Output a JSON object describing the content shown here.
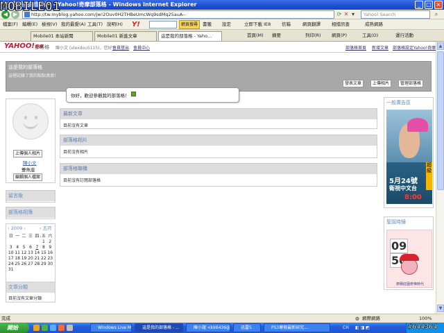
{
  "watermark": "MOBILE01",
  "window": {
    "title": "我是我的部落格 - Yahoo!奇摩部落格 - Windows Internet Explorer",
    "min": "_",
    "max": "□",
    "close": "×"
  },
  "address": {
    "url": "http://tw.myblog.yahoo.com/jw!2Ouv0H2THBeUmcWq9sdMq25auA--",
    "search_placeholder": "Yahoo! Search"
  },
  "menu": [
    "檔案(F)",
    "編輯(E)",
    "檢視(V)",
    "我的最愛(A)",
    "工具(T)",
    "說明(H)"
  ],
  "toolbar": {
    "search_btn": "網頁搜尋",
    "items": [
      "書籤",
      "設定",
      "立即下載 IE8",
      "信箱",
      "網頁翻譯",
      "相擋訊查",
      "成熟網路"
    ]
  },
  "tabs": [
    "Mobile01 本站新聞",
    "Mobile01 新進文章",
    "這是我的部落格 - Yaho..."
  ],
  "commands": [
    "首頁(M)",
    "摘要",
    "列印(R)",
    "網頁(P)",
    "工具(O)",
    "運行活動"
  ],
  "site": {
    "logo": "YAHOO!",
    "logo_sub": "奇摩",
    "label": "部落格",
    "greeting": "陳小文 (vlexdou5115)，您好！",
    "links_left": [
      "會員登出",
      "會員中心"
    ],
    "links_right": [
      "部落格首頁",
      "新增文章",
      "部落格設定",
      "Yahoo!奇摩"
    ]
  },
  "banner": {
    "title": "這是我的部落格",
    "subtitle": "這裡記錄了我的點點滴滴！",
    "buttons": [
      "發表文章",
      "上傳相片",
      "管理部落格"
    ]
  },
  "welcome": "你好，歡迎參觀我的部落格！",
  "profile": {
    "upload_btn": "上傳個人相片",
    "name": "陳小文",
    "sign": "雙魚座",
    "edit_btn": "編輯個人檔案"
  },
  "left_boxes": {
    "guestbook": "留言版",
    "album": "部落格相簿",
    "category": "文章分類",
    "category_body": "目前沒有文章分類"
  },
  "calendar": {
    "year": "2009",
    "month": "五月",
    "weekdays": [
      "日",
      "一",
      "二",
      "三",
      "四",
      "五",
      "六"
    ],
    "rows": [
      [
        "",
        "",
        "",
        "",
        "",
        "1",
        "2"
      ],
      [
        "3",
        "4",
        "5",
        "6",
        "7",
        "8",
        "9"
      ],
      [
        "10",
        "11",
        "12",
        "13",
        "14",
        "15",
        "16"
      ],
      [
        "17",
        "18",
        "19",
        "20",
        "21",
        "22",
        "23"
      ],
      [
        "24",
        "25",
        "26",
        "27",
        "28",
        "29",
        "30"
      ],
      [
        "31",
        "",
        "",
        "",
        "",
        "",
        ""
      ]
    ]
  },
  "middle": [
    {
      "title": "最新文章",
      "body": "目前沒有文章"
    },
    {
      "title": "部落格相片",
      "body": "目前沒有相片"
    },
    {
      "title": "部落格聯播",
      "body": "目前沒有訂閱部落格"
    }
  ],
  "right": {
    "ad_title": "一般廣告區",
    "ad_date": "5月24號",
    "ad_channel": "衛視中文台",
    "ad_time": "8:00",
    "ad_vertical": "超級",
    "clock_title": "聖誕時鐘",
    "clock_hour": "09",
    "clock_min": "50",
    "clock_caption": "摩爾莊園奇樂時代"
  },
  "status": {
    "left": "完成",
    "zone": "網際網路",
    "zoom": "100%"
  },
  "taskbar": {
    "start": "開始",
    "tasks": [
      "Windows Live Mes...",
      "這是我的部落格 - ...",
      "陳小誼 <kk6436@...",
      "迅雷5",
      "PS3寒假最新研究..."
    ],
    "stamp": "#644364"
  }
}
